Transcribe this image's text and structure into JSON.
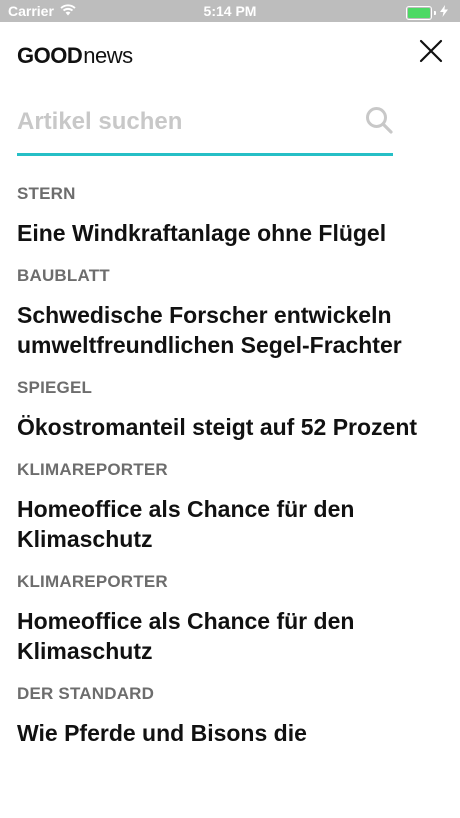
{
  "status_bar": {
    "carrier": "Carrier",
    "time": "5:14 PM",
    "battery_color": "#4cd964",
    "battery_level": 1.0
  },
  "header": {
    "logo_bold": "GOOD",
    "logo_regular": "news",
    "close_icon": "close-icon"
  },
  "search": {
    "placeholder": "Artikel suchen",
    "value": "",
    "accent_color": "#26bfc6",
    "icon": "search-icon"
  },
  "articles": [
    {
      "source": "STERN",
      "title": "Eine Windkraftanlage ohne Flügel"
    },
    {
      "source": "BAUBLATT",
      "title": "Schwedische Forscher entwickeln umweltfreundlichen Segel-Frachter"
    },
    {
      "source": "SPIEGEL",
      "title": "Ökostromanteil steigt auf 52 Prozent"
    },
    {
      "source": "KLIMAREPORTER",
      "title": "Homeoffice als Chance für den Klimaschutz"
    },
    {
      "source": "KLIMAREPORTER",
      "title": "Homeoffice als Chance für den Klimaschutz"
    },
    {
      "source": "DER STANDARD",
      "title": "Wie Pferde und Bisons die"
    }
  ]
}
